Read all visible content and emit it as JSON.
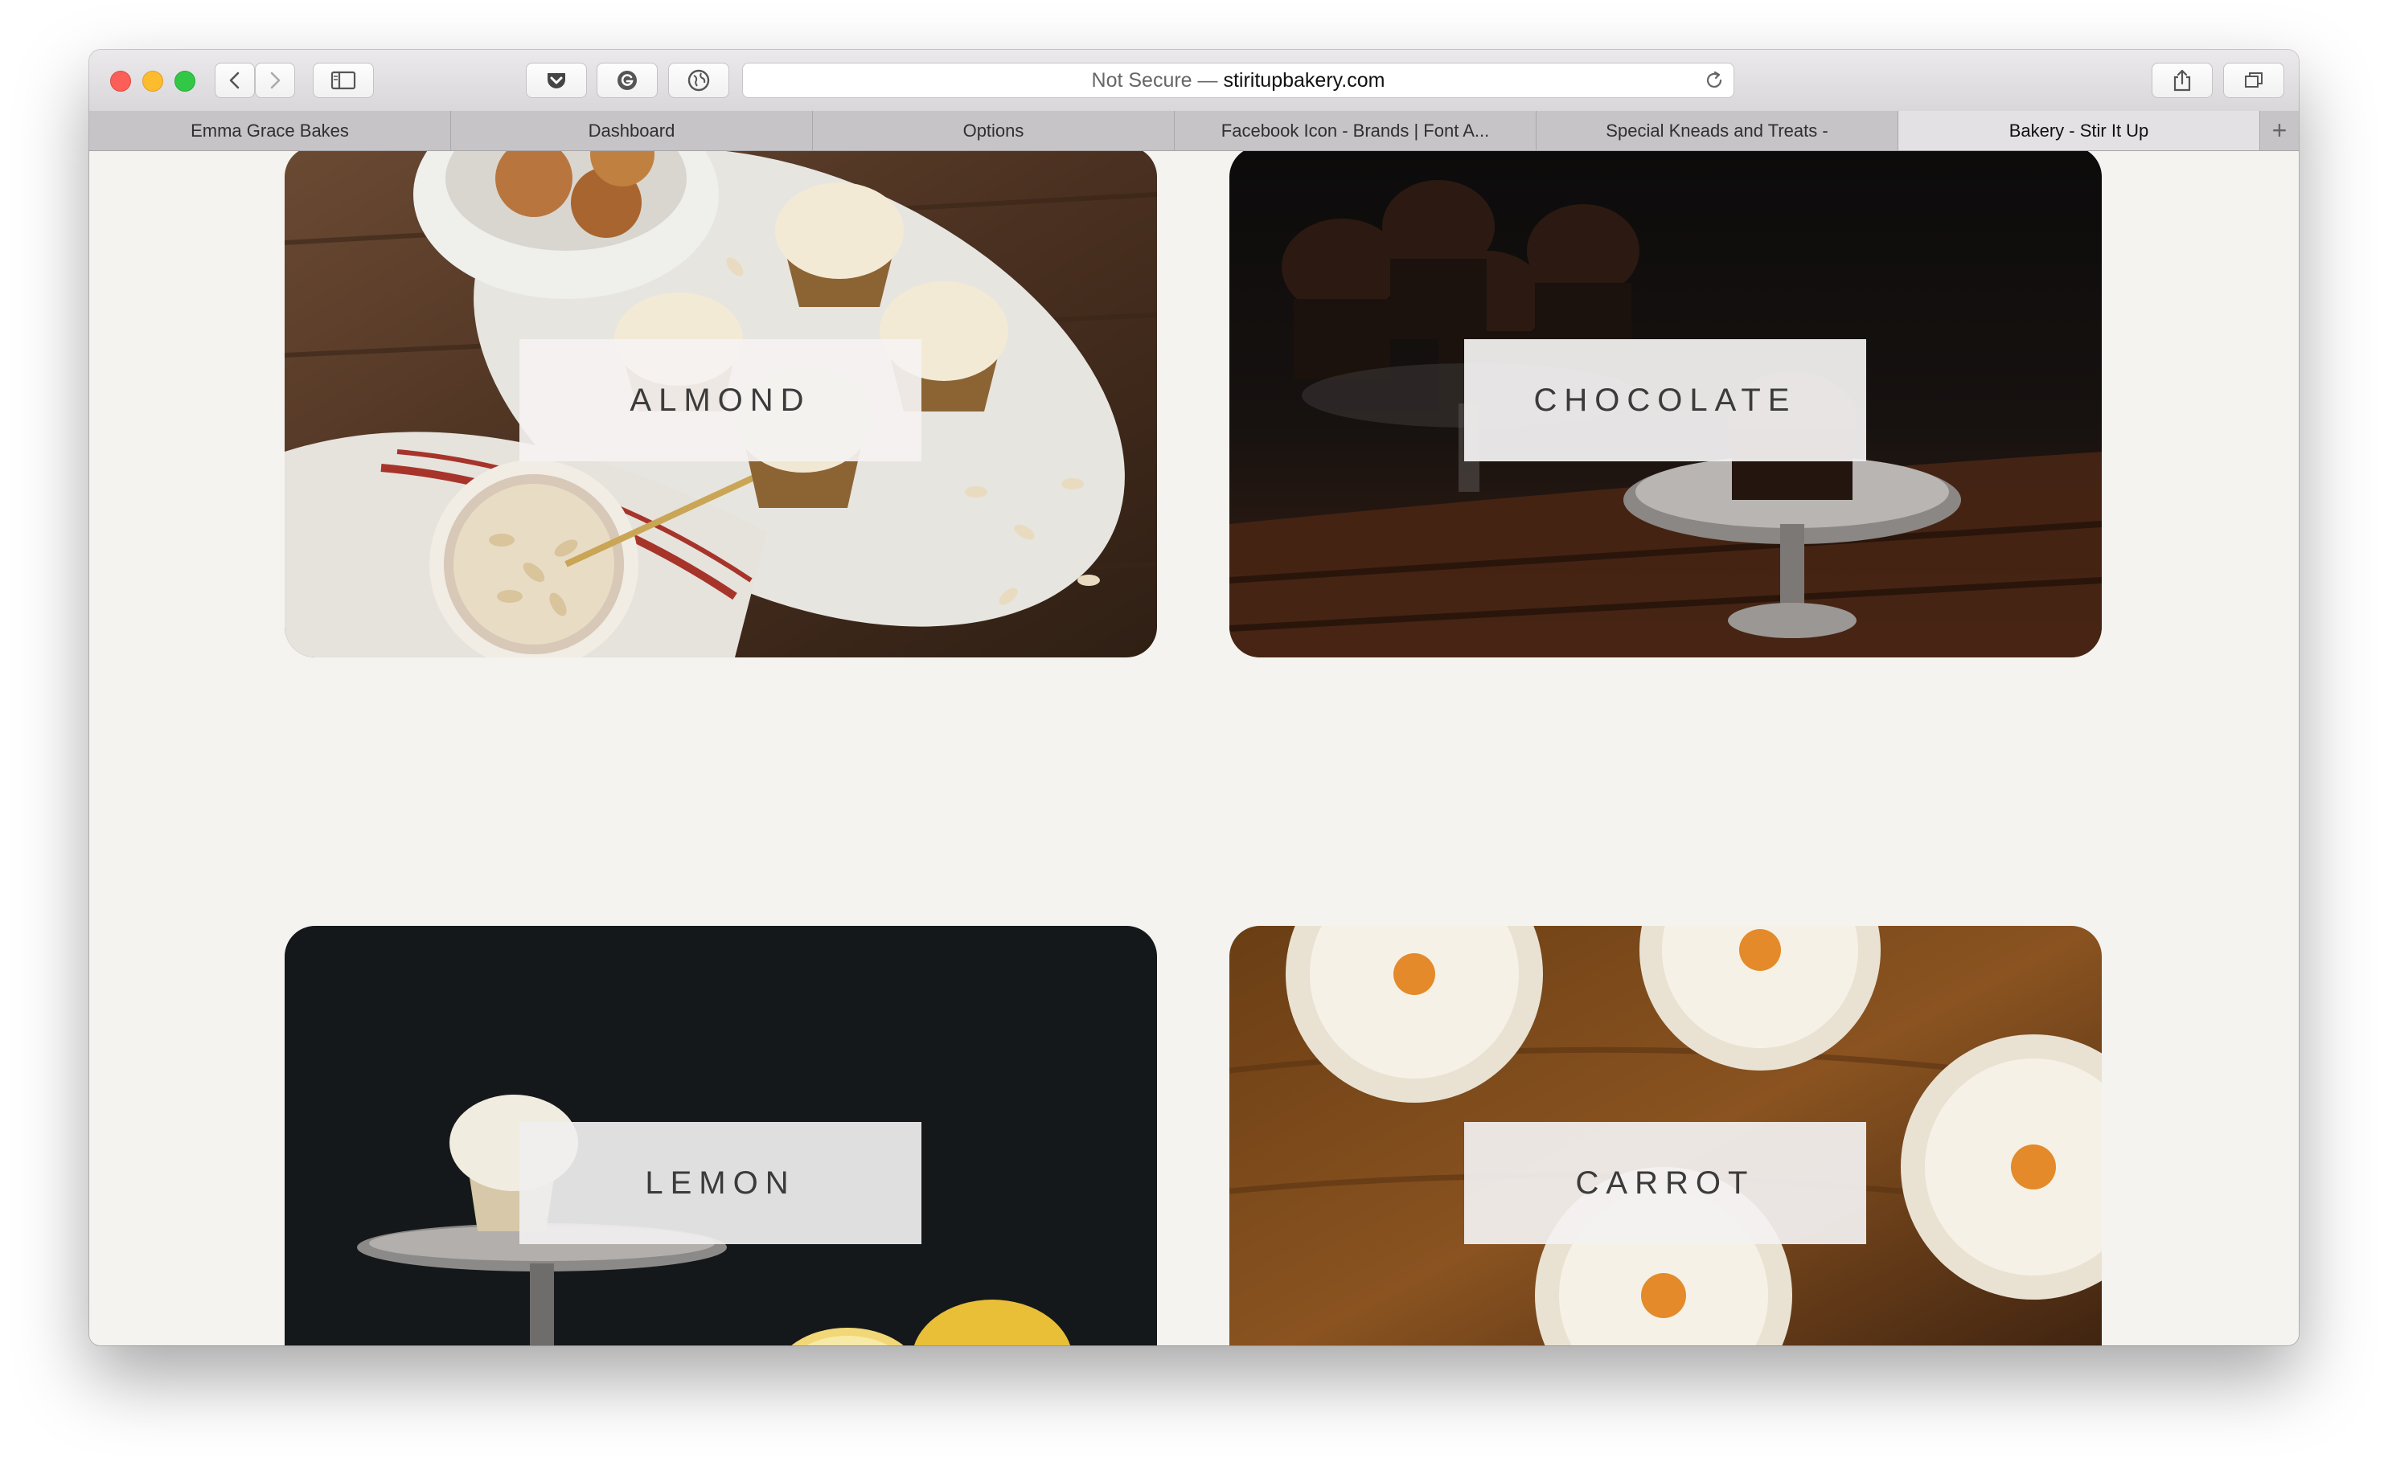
{
  "browser": {
    "address": {
      "security": "Not Secure",
      "separator": " — ",
      "domain": "stiritupbakery.com"
    },
    "tabs": [
      {
        "label": "Emma Grace Bakes",
        "active": false
      },
      {
        "label": "Dashboard",
        "active": false
      },
      {
        "label": "Options",
        "active": false
      },
      {
        "label": "Facebook Icon - Brands | Font A...",
        "active": false
      },
      {
        "label": "Special Kneads and Treats -",
        "active": false
      },
      {
        "label": "Bakery - Stir It Up",
        "active": true
      }
    ],
    "new_tab_label": "+"
  },
  "flavors": [
    {
      "label": "ALMOND",
      "photo": "cupcakes-with-almonds-and-eggs"
    },
    {
      "label": "CHOCOLATE",
      "photo": "chocolate-cupcakes-on-cake-stand"
    },
    {
      "label": "LEMON",
      "photo": "cupcake-on-stand-with-lemons"
    },
    {
      "label": "CARROT",
      "photo": "carrot-cupcakes-on-wood"
    }
  ],
  "colors": {
    "page_background": "#f4f3ef",
    "label_box_light": "#f3f1f1",
    "label_text": "#3b3b3b",
    "traffic_close": "#fc5f57",
    "traffic_minimize": "#fdbc2e",
    "traffic_maximize": "#33c748"
  }
}
